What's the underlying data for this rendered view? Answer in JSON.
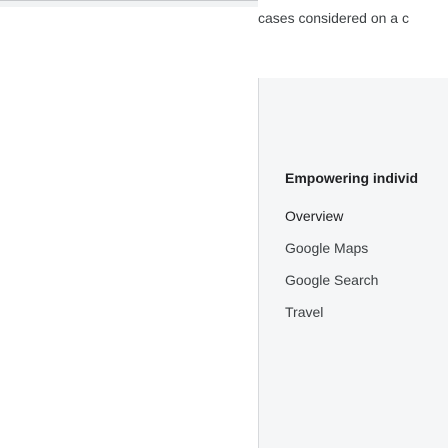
{
  "header": {
    "caption": "cases considered on a c"
  },
  "sidebar": {
    "heading": "Empowering individ",
    "items": [
      {
        "label": "Overview"
      },
      {
        "label": "Google Maps"
      },
      {
        "label": "Google Search"
      },
      {
        "label": "Travel"
      }
    ]
  }
}
